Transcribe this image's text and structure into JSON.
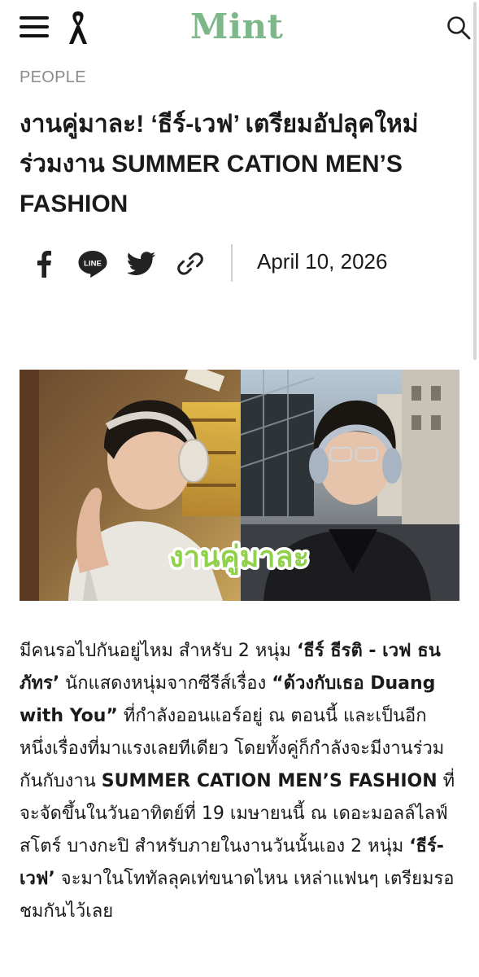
{
  "header": {
    "logo": "Mint",
    "menu_icon": "hamburger-menu-icon",
    "mourning_icon": "black-ribbon-icon",
    "search_icon": "search-icon",
    "logo_color": "#7cb88a"
  },
  "article": {
    "category": "PEOPLE",
    "title": "งานคู่มาละ! ‘ธีร์-เวฟ’ เตรียมอัปลุคใหม่ร่วมงาน SUMMER CATION MEN’S FASHION",
    "date": "April 10, 2026",
    "share": [
      {
        "name": "facebook",
        "icon": "facebook-icon"
      },
      {
        "name": "line",
        "icon": "line-icon",
        "label": "LINE"
      },
      {
        "name": "twitter",
        "icon": "twitter-icon"
      },
      {
        "name": "copy-link",
        "icon": "link-icon"
      }
    ],
    "hero_caption": "งานคู่มาละ",
    "body": [
      {
        "text": "มีคนรอไปกันอยู่ไหม สำหรับ 2 หนุ่ม ",
        "bold": false
      },
      {
        "text": "‘ธีร์ ธีรติ - เวฟ ธนภัทร’",
        "bold": true
      },
      {
        "text": " นักแสดงหนุ่มจากซีรีส์เรื่อง ",
        "bold": false
      },
      {
        "text": "“ด้วงกับเธอ Duang with You”",
        "bold": true
      },
      {
        "text": " ที่กำลังออนแอร์อยู่ ณ ตอนนี้ และเป็นอีกหนึ่งเรื่องที่มาแรงเลยทีเดียว โดยทั้งคู่ก็กำลังจะมีงานร่วมกันกับงาน ",
        "bold": false
      },
      {
        "text": "SUMMER CATION MEN’S FASHION",
        "bold": true
      },
      {
        "text": " ที่จะจัดขึ้นในวันอาทิตย์ที่ 19 เมษายนนี้ ณ เดอะมอลล์ไลฟ์สโตร์ บางกะปิ สำหรับภายในงานวันนั้นเอง 2 หนุ่ม ",
        "bold": false
      },
      {
        "text": "‘ธีร์-เวฟ’",
        "bold": true
      },
      {
        "text": " จะมาในโททัลลุคเท่ขนาดไหน เหล่าแฟนๆ เตรียมรอชมกันไว้เลย",
        "bold": false
      }
    ]
  }
}
